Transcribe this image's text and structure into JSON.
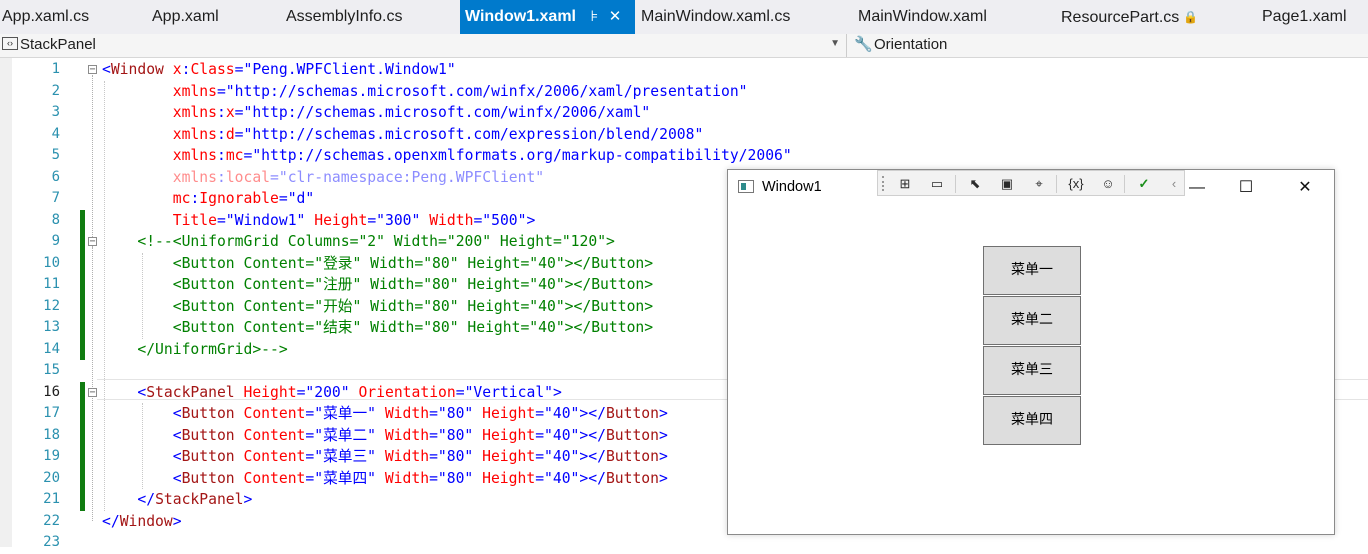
{
  "tabs": [
    {
      "label": "App.xaml.cs",
      "active": false,
      "locked": false
    },
    {
      "label": "App.xaml",
      "active": false,
      "locked": false
    },
    {
      "label": "AssemblyInfo.cs",
      "active": false,
      "locked": false
    },
    {
      "label": "Window1.xaml",
      "active": true,
      "locked": false,
      "pin_glyph": "⊧",
      "close_glyph": "✕"
    },
    {
      "label": "MainWindow.xaml.cs",
      "active": false,
      "locked": false
    },
    {
      "label": "MainWindow.xaml",
      "active": false,
      "locked": false
    },
    {
      "label": "ResourcePart.cs",
      "active": false,
      "locked": true
    },
    {
      "label": "Page1.xaml",
      "active": false,
      "locked": false
    }
  ],
  "navbar": {
    "left_label": "StackPanel",
    "right_label": "Orientation",
    "left_icon": "element-icon",
    "right_icon": "wrench-icon"
  },
  "editor": {
    "current_line": 16,
    "lines": [
      {
        "n": "1",
        "t": [
          [
            "b",
            "<"
          ],
          [
            "m",
            "Window"
          ],
          [
            "t",
            " "
          ],
          [
            "r",
            "x"
          ],
          [
            "b",
            ":"
          ],
          [
            "r",
            "Class"
          ],
          [
            "b",
            "=\"Peng.WPFClient.Window1\""
          ]
        ]
      },
      {
        "n": "2",
        "t": [
          [
            "t",
            "        "
          ],
          [
            "r",
            "xmlns"
          ],
          [
            "b",
            "=\"http://schemas.microsoft.com/winfx/2006/xaml/presentation\""
          ]
        ]
      },
      {
        "n": "3",
        "t": [
          [
            "t",
            "        "
          ],
          [
            "r",
            "xmlns"
          ],
          [
            "b",
            ":"
          ],
          [
            "r",
            "x"
          ],
          [
            "b",
            "=\"http://schemas.microsoft.com/winfx/2006/xaml\""
          ]
        ]
      },
      {
        "n": "4",
        "t": [
          [
            "t",
            "        "
          ],
          [
            "r",
            "xmlns"
          ],
          [
            "b",
            ":"
          ],
          [
            "r",
            "d"
          ],
          [
            "b",
            "=\"http://schemas.microsoft.com/expression/blend/2008\""
          ]
        ]
      },
      {
        "n": "5",
        "t": [
          [
            "t",
            "        "
          ],
          [
            "r",
            "xmlns"
          ],
          [
            "b",
            ":"
          ],
          [
            "r",
            "mc"
          ],
          [
            "b",
            "=\"http://schemas.openxmlformats.org/markup-compatibility/2006\""
          ]
        ]
      },
      {
        "n": "6",
        "faded": true,
        "t": [
          [
            "t",
            "        "
          ],
          [
            "r",
            "xmlns"
          ],
          [
            "b",
            ":"
          ],
          [
            "r",
            "local"
          ],
          [
            "b",
            "=\"clr-namespace:Peng.WPFClient\""
          ]
        ]
      },
      {
        "n": "7",
        "t": [
          [
            "t",
            "        "
          ],
          [
            "r",
            "mc"
          ],
          [
            "b",
            ":"
          ],
          [
            "r",
            "Ignorable"
          ],
          [
            "b",
            "=\"d\""
          ]
        ]
      },
      {
        "n": "8",
        "t": [
          [
            "t",
            "        "
          ],
          [
            "r",
            "Title"
          ],
          [
            "b",
            "=\"Window1\""
          ],
          [
            "t",
            " "
          ],
          [
            "r",
            "Height"
          ],
          [
            "b",
            "=\"300\""
          ],
          [
            "t",
            " "
          ],
          [
            "r",
            "Width"
          ],
          [
            "b",
            "=\"500\""
          ],
          [
            "b",
            ">"
          ]
        ]
      },
      {
        "n": "9",
        "t": [
          [
            "t",
            "    "
          ],
          [
            "g",
            "<!--<UniformGrid Columns=\"2\" Width=\"200\" Height=\"120\">"
          ]
        ]
      },
      {
        "n": "10",
        "t": [
          [
            "t",
            "        "
          ],
          [
            "g",
            "<Button Content=\"登录\" Width=\"80\" Height=\"40\"></Button>"
          ]
        ]
      },
      {
        "n": "11",
        "t": [
          [
            "t",
            "        "
          ],
          [
            "g",
            "<Button Content=\"注册\" Width=\"80\" Height=\"40\"></Button>"
          ]
        ]
      },
      {
        "n": "12",
        "t": [
          [
            "t",
            "        "
          ],
          [
            "g",
            "<Button Content=\"开始\" Width=\"80\" Height=\"40\"></Button>"
          ]
        ]
      },
      {
        "n": "13",
        "t": [
          [
            "t",
            "        "
          ],
          [
            "g",
            "<Button Content=\"结束\" Width=\"80\" Height=\"40\"></Button>"
          ]
        ]
      },
      {
        "n": "14",
        "t": [
          [
            "t",
            "    "
          ],
          [
            "g",
            "</UniformGrid>-->"
          ]
        ]
      },
      {
        "n": "15",
        "t": []
      },
      {
        "n": "16",
        "t": [
          [
            "t",
            "    "
          ],
          [
            "b",
            "<"
          ],
          [
            "m",
            "StackPanel"
          ],
          [
            "t",
            " "
          ],
          [
            "r",
            "Height"
          ],
          [
            "b",
            "=\"200\""
          ],
          [
            "t",
            " "
          ],
          [
            "r",
            "Orientation"
          ],
          [
            "b",
            "=\"Vertical\""
          ],
          [
            "b",
            ">"
          ]
        ]
      },
      {
        "n": "17",
        "t": [
          [
            "t",
            "        "
          ],
          [
            "b",
            "<"
          ],
          [
            "m",
            "Button"
          ],
          [
            "t",
            " "
          ],
          [
            "r",
            "Content"
          ],
          [
            "b",
            "=\"菜单一\""
          ],
          [
            "t",
            " "
          ],
          [
            "r",
            "Width"
          ],
          [
            "b",
            "=\"80\""
          ],
          [
            "t",
            " "
          ],
          [
            "r",
            "Height"
          ],
          [
            "b",
            "=\"40\""
          ],
          [
            "b",
            "></"
          ],
          [
            "m",
            "Button"
          ],
          [
            "b",
            ">"
          ]
        ]
      },
      {
        "n": "18",
        "t": [
          [
            "t",
            "        "
          ],
          [
            "b",
            "<"
          ],
          [
            "m",
            "Button"
          ],
          [
            "t",
            " "
          ],
          [
            "r",
            "Content"
          ],
          [
            "b",
            "=\"菜单二\""
          ],
          [
            "t",
            " "
          ],
          [
            "r",
            "Width"
          ],
          [
            "b",
            "=\"80\""
          ],
          [
            "t",
            " "
          ],
          [
            "r",
            "Height"
          ],
          [
            "b",
            "=\"40\""
          ],
          [
            "b",
            "></"
          ],
          [
            "m",
            "Button"
          ],
          [
            "b",
            ">"
          ]
        ]
      },
      {
        "n": "19",
        "t": [
          [
            "t",
            "        "
          ],
          [
            "b",
            "<"
          ],
          [
            "m",
            "Button"
          ],
          [
            "t",
            " "
          ],
          [
            "r",
            "Content"
          ],
          [
            "b",
            "=\"菜单三\""
          ],
          [
            "t",
            " "
          ],
          [
            "r",
            "Width"
          ],
          [
            "b",
            "=\"80\""
          ],
          [
            "t",
            " "
          ],
          [
            "r",
            "Height"
          ],
          [
            "b",
            "=\"40\""
          ],
          [
            "b",
            "></"
          ],
          [
            "m",
            "Button"
          ],
          [
            "b",
            ">"
          ]
        ]
      },
      {
        "n": "20",
        "t": [
          [
            "t",
            "        "
          ],
          [
            "b",
            "<"
          ],
          [
            "m",
            "Button"
          ],
          [
            "t",
            " "
          ],
          [
            "r",
            "Content"
          ],
          [
            "b",
            "=\"菜单四\""
          ],
          [
            "t",
            " "
          ],
          [
            "r",
            "Width"
          ],
          [
            "b",
            "=\"80\""
          ],
          [
            "t",
            " "
          ],
          [
            "r",
            "Height"
          ],
          [
            "b",
            "=\"40\""
          ],
          [
            "b",
            "></"
          ],
          [
            "m",
            "Button"
          ],
          [
            "b",
            ">"
          ]
        ]
      },
      {
        "n": "21",
        "t": [
          [
            "t",
            "    "
          ],
          [
            "b",
            "</"
          ],
          [
            "m",
            "StackPanel"
          ],
          [
            "b",
            ">"
          ]
        ]
      },
      {
        "n": "22",
        "t": [
          [
            "b",
            "</"
          ],
          [
            "m",
            "Window"
          ],
          [
            "b",
            ">"
          ]
        ]
      },
      {
        "n": "23",
        "t": []
      }
    ]
  },
  "preview": {
    "title": "Window1",
    "min_glyph": "—",
    "max_glyph": "☐",
    "close_glyph": "✕",
    "toolbar_icons": [
      {
        "name": "select-element-icon",
        "glyph": "⊞"
      },
      {
        "name": "record-icon",
        "glyph": "▭"
      },
      {
        "name": "pointer-icon",
        "glyph": "⬉"
      },
      {
        "name": "adorner-icon",
        "glyph": "▣"
      },
      {
        "name": "track-focus-icon",
        "glyph": "⌖"
      },
      {
        "name": "binding-errors-icon",
        "glyph": "{x}"
      },
      {
        "name": "accessibility-icon",
        "glyph": "☺"
      },
      {
        "name": "check-icon",
        "glyph": "✓"
      },
      {
        "name": "collapse-icon",
        "glyph": "‹"
      }
    ],
    "buttons": [
      "菜单一",
      "菜单二",
      "菜单三",
      "菜单四"
    ]
  },
  "colors": {
    "accent": "#007acc",
    "xml_bracket": "#0000ff",
    "xml_element": "#a31515",
    "xml_attribute": "#ff0000",
    "xml_comment": "#008000",
    "line_number": "#2b91af",
    "change_bar": "#107c10"
  }
}
